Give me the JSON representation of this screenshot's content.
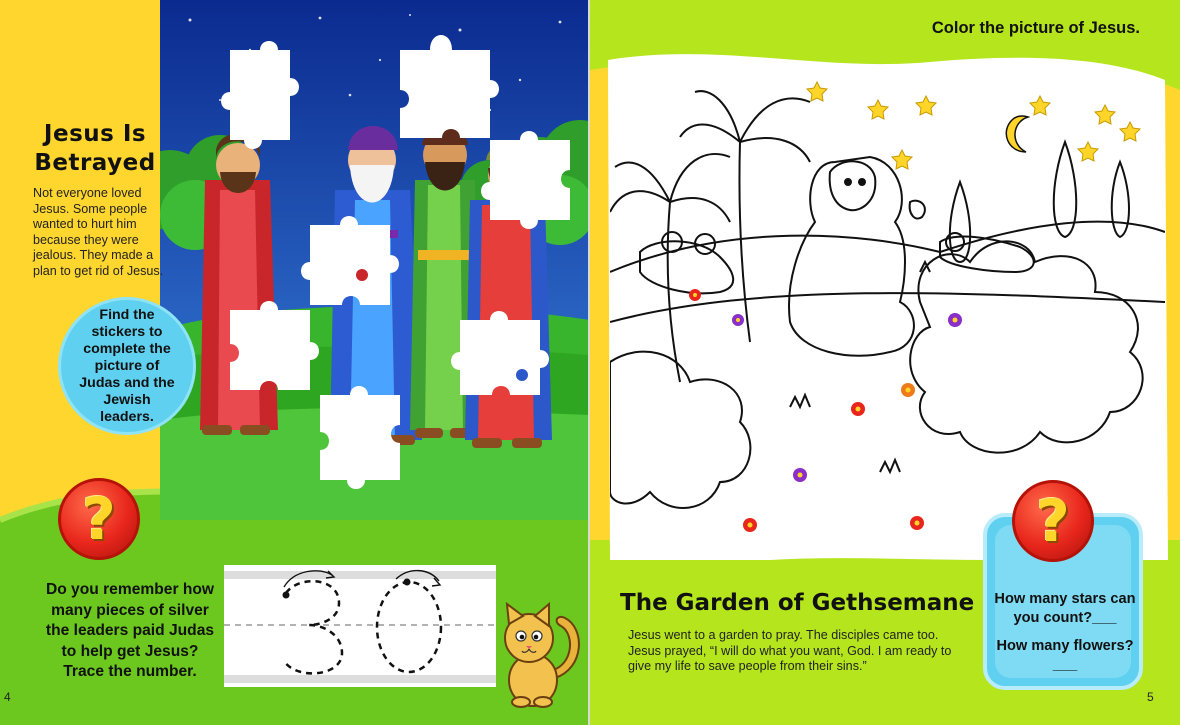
{
  "left_page": {
    "title_line1": "Jesus Is",
    "title_line2": "Betrayed",
    "body": "Not everyone loved Jesus. Some people wanted to hurt him because they were jealous. They made a plan to get rid of Jesus.",
    "sticker_instruction": "Find the stickers to complete the picture of Judas and the Jewish leaders.",
    "question_mark": "?",
    "question": "Do you remember how many pieces of silver the leaders paid Judas to help get Jesus? Trace the number.",
    "trace_number": "30",
    "page_number": "4"
  },
  "right_page": {
    "instruction": "Color the picture of Jesus.",
    "title": "The Garden of Gethsemane",
    "body": "Jesus went to a garden to pray. The disciples came too. Jesus prayed, “I will do what you want, God. I am ready to give my life to save people from their sins.”",
    "question_mark": "?",
    "question_stars": "How many stars can you count?___",
    "question_flowers": "How many flowers?___",
    "page_number": "5"
  },
  "colors": {
    "yellow": "#ffd62e",
    "green": "#6cc81f",
    "lime": "#b5e51d",
    "sky_blue": "#5fd0ef",
    "question_red": "#e8261c",
    "question_gold": "#ffd52a"
  }
}
